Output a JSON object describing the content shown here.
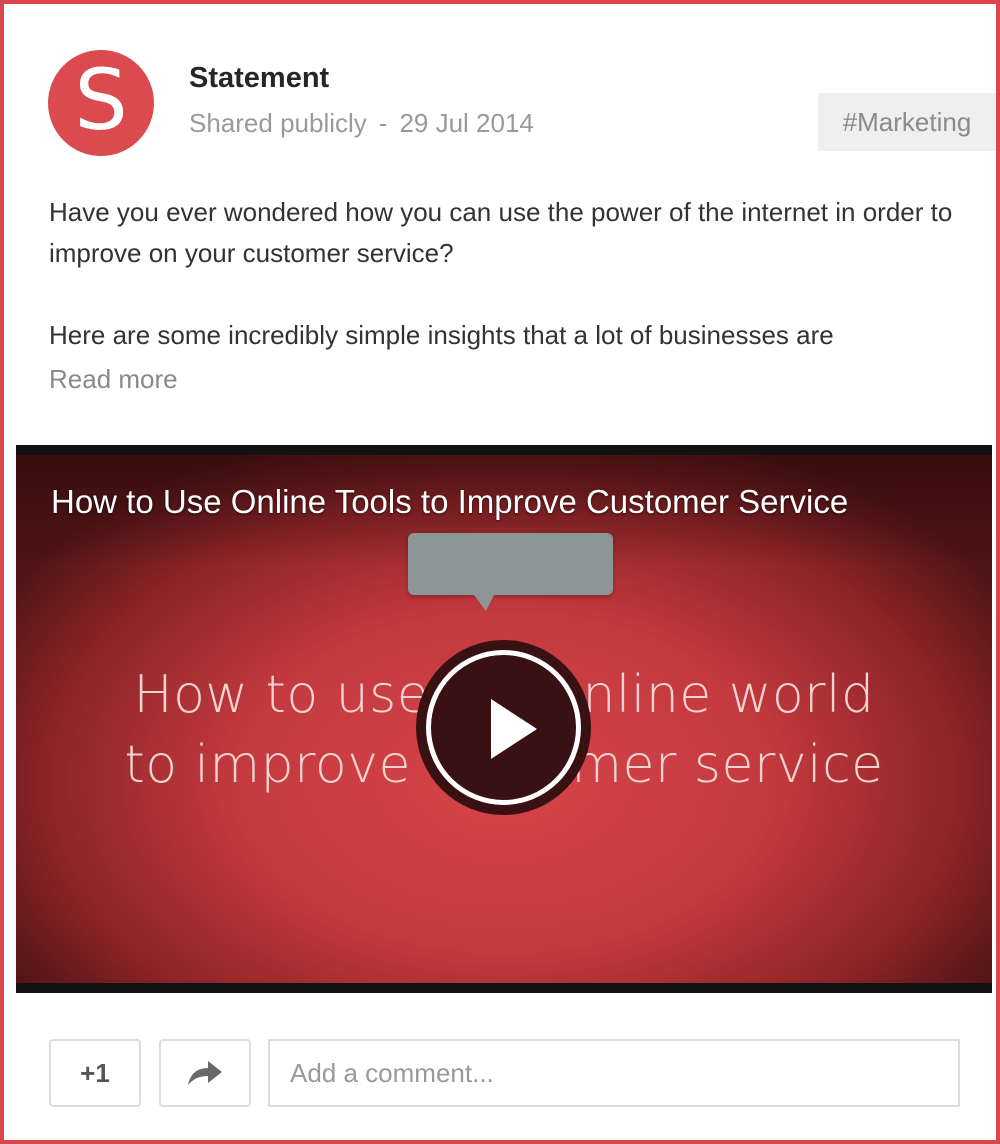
{
  "post": {
    "avatar_letter": "S",
    "author": "Statement",
    "visibility": "Shared publicly",
    "separator": "-",
    "date": "29 Jul 2014",
    "hashtag": "#Marketing",
    "paragraph1": "Have you ever wondered how you can use the power of the internet in order to improve on your customer service?",
    "paragraph2": "Here are some incredibly simple insights that a lot of businesses are",
    "read_more": "Read more"
  },
  "video": {
    "title": "How to Use Online Tools to Improve Customer Service",
    "slide_line1": "How to use the online world",
    "slide_line2": "to improve customer service"
  },
  "actions": {
    "plus_one": "+1",
    "share_icon": "share-arrow-icon",
    "comment_placeholder": "Add a comment..."
  },
  "colors": {
    "brand_red": "#db4a4f",
    "border_red": "#d9474b"
  }
}
